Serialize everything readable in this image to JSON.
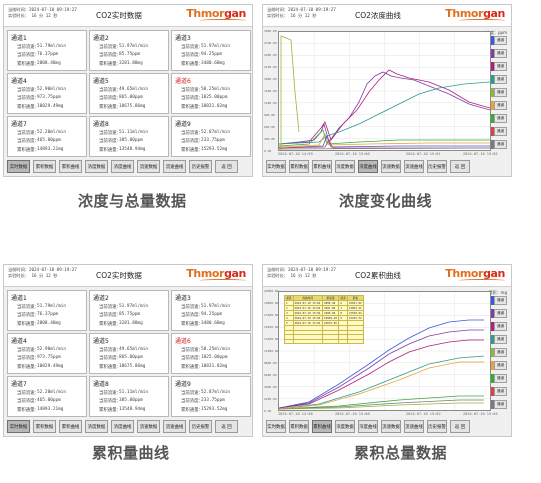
{
  "captions": [
    "浓度与总量数据",
    "浓度变化曲线",
    "累积量曲线",
    "累积总量数据"
  ],
  "header": {
    "time_line": "当前时间：2024-07-10 09:19:27",
    "elapsed_line": "实验时长：   16  分   12  秒",
    "title_realtime": "CO2实时数据",
    "title_conc_curve": "CO2浓度曲线",
    "title_cum_curve": "CO2累积曲线",
    "logo_part1": "Thmor",
    "logo_part2": "gan"
  },
  "labels": {
    "flow": "当前流速：",
    "conc": "当前浓度：",
    "cum": "累积通量："
  },
  "channels": [
    {
      "name": "通道1",
      "flow": "51.79ml/min",
      "conc": "76.37ppm",
      "cum": "2808.48mg",
      "alarm": false
    },
    {
      "name": "通道2",
      "flow": "51.97ml/min",
      "conc": "85.75ppm",
      "cum": "3281.88mg",
      "alarm": false
    },
    {
      "name": "通道3",
      "flow": "51.97ml/min",
      "conc": "94.25ppm",
      "cum": "3480.68mg",
      "alarm": false
    },
    {
      "name": "通道4",
      "flow": "52.90ml/min",
      "conc": "973.75ppm",
      "cum": "10829.49mg",
      "alarm": false
    },
    {
      "name": "通道5",
      "flow": "49.65ml/min",
      "conc": "865.00ppm",
      "cum": "10675.86mg",
      "alarm": false
    },
    {
      "name": "通道6",
      "flow": "50.25ml/min",
      "conc": "1025.00ppm",
      "cum": "10831.82mg",
      "alarm": true
    },
    {
      "name": "通道7",
      "flow": "52.20ml/min",
      "conc": "465.00ppm",
      "cum": "14893.21mg",
      "alarm": false
    },
    {
      "name": "通道8",
      "flow": "51.11ml/min",
      "conc": "385.00ppm",
      "cum": "13548.94mg",
      "alarm": false
    },
    {
      "name": "通道9",
      "flow": "52.87ml/min",
      "conc": "233.75ppm",
      "cum": "15293.52mg",
      "alarm": false
    }
  ],
  "toolbar_wide": [
    "实时数据",
    "累积数据",
    "累积曲线",
    "浓度数据",
    "浓度曲线",
    "流速数据",
    "流速曲线",
    "历史报警",
    "返 回"
  ],
  "toolbar_small": [
    "实时数据",
    "累积数据",
    "累积曲线",
    "浓度数据",
    "浓度曲线",
    "流速数据",
    "流速曲线",
    "历史报警",
    "返 回"
  ],
  "active_tabs": {
    "p1": 0,
    "p2": 4,
    "p3": 0,
    "p4": 2
  },
  "conc_chart": {
    "unit": "浓度：ppm",
    "legend_label": "通道",
    "y_ticks": [
      "3000.00",
      "2700.00",
      "2400.00",
      "2100.00",
      "1800.00",
      "1500.00",
      "1200.00",
      "900.00",
      "600.00",
      "300.00",
      "0.00"
    ],
    "x_ticks": [
      "2024-07-10 14:59",
      "2024-07-10 15:00",
      "2024-07-10 15:01",
      "2024-07-10 15:02"
    ],
    "x_end": "2024-07-10 15:02"
  },
  "cum_chart": {
    "unit": "累积：mg",
    "legend_label": "通道",
    "y_ticks": [
      "22000.00",
      "19800.00",
      "17600.00",
      "15400.00",
      "13200.00",
      "11000.00",
      "8800.00",
      "6600.00",
      "4400.00",
      "2200.00",
      "0.00"
    ],
    "x_ticks": [
      "2024-07-10 14:58",
      "2024-07-10 15:00",
      "2024-07-10 15:02",
      "2024-07-10 15:04"
    ]
  },
  "cum_table": {
    "headers": [
      "通道",
      "当前时间",
      "累积量",
      "通道",
      "累积"
    ],
    "rows": [
      [
        "1",
        "2024-07-10 15:04",
        "2808.48",
        "6",
        "10831.82"
      ],
      [
        "2",
        "2024-07-10 15:04",
        "3281.88",
        "7",
        "14893.21"
      ],
      [
        "3",
        "2024-07-10 15:04",
        "3480.68",
        "8",
        "13548.94"
      ],
      [
        "4",
        "2024-07-10 15:04",
        "10829.49",
        "9",
        "15293.52"
      ],
      [
        "5",
        "2024-07-10 15:04",
        "10675.86",
        "",
        ""
      ],
      [
        "",
        "",
        "",
        "",
        ""
      ],
      [
        "",
        "",
        "",
        "",
        ""
      ],
      [
        "",
        "",
        "",
        "",
        ""
      ],
      [
        "",
        "",
        "",
        "",
        ""
      ]
    ]
  },
  "series_colors": [
    "#3b5bdb",
    "#7b3fa8",
    "#b0207a",
    "#2a9d8f",
    "#8fb83a",
    "#e8a33c",
    "#3aa83a",
    "#d64545",
    "#7a7a7a"
  ]
}
